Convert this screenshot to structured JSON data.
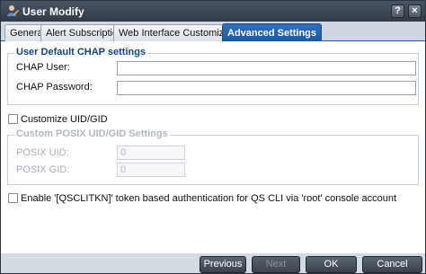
{
  "window": {
    "title": "User Modify",
    "help_symbol": "?",
    "close_symbol": "×"
  },
  "tabs": [
    {
      "label": "General",
      "active": false
    },
    {
      "label": "Alert Subscriptions",
      "active": false
    },
    {
      "label": "Web Interface Customization",
      "active": false
    },
    {
      "label": "Advanced Settings",
      "active": true
    }
  ],
  "chap": {
    "legend": "User Default CHAP settings",
    "user_label": "CHAP User:",
    "user_value": "",
    "password_label": "CHAP Password:",
    "password_value": ""
  },
  "uid_gid": {
    "checkbox_label": "Customize UID/GID",
    "checked": false,
    "legend": "Custom POSIX UID/GID Settings",
    "uid_label": "POSIX UID:",
    "uid_value": "0",
    "gid_label": "POSIX GID:",
    "gid_value": "0"
  },
  "token": {
    "checkbox_label": "Enable '[QSCLITKN]' token based authentication for QS CLI via 'root' console account",
    "checked": false
  },
  "buttons": {
    "previous": "Previous",
    "next": "Next",
    "ok": "OK",
    "cancel": "Cancel"
  },
  "colors": {
    "accent": "#1d56a1",
    "legend_text": "#15428b",
    "titlebar": "#3a4451"
  }
}
